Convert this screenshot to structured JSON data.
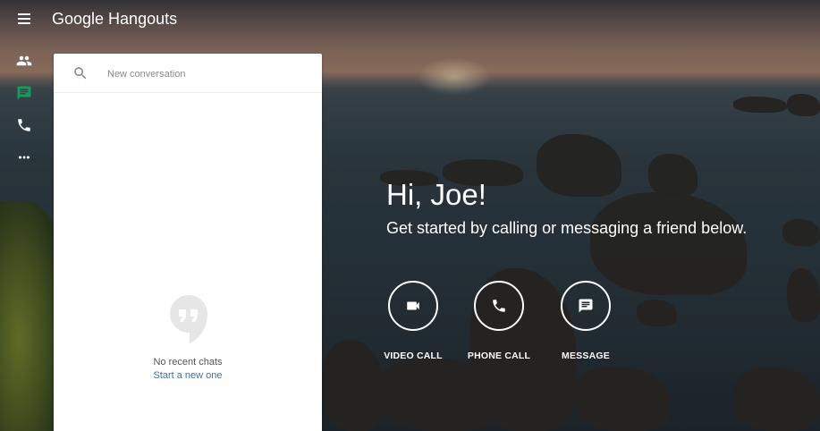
{
  "app": {
    "title": "Google Hangouts"
  },
  "rail": {
    "items": [
      {
        "name": "contacts",
        "icon": "people-icon"
      },
      {
        "name": "conversations",
        "icon": "chat-icon",
        "active": true
      },
      {
        "name": "phone-calls",
        "icon": "phone-icon"
      },
      {
        "name": "more",
        "icon": "more-horiz-icon"
      }
    ]
  },
  "search": {
    "placeholder": "New conversation",
    "value": ""
  },
  "empty_state": {
    "text": "No recent chats",
    "link": "Start a new one"
  },
  "welcome": {
    "greeting": "Hi, Joe!",
    "subtitle": "Get started by calling or messaging a friend below."
  },
  "actions": [
    {
      "label": "VIDEO CALL",
      "icon": "videocam-icon"
    },
    {
      "label": "PHONE CALL",
      "icon": "phone-icon"
    },
    {
      "label": "MESSAGE",
      "icon": "message-icon"
    }
  ],
  "colors": {
    "active_green": "#0f9d58",
    "link_blue": "#3b6fb6",
    "panel_bg": "#ffffff"
  }
}
